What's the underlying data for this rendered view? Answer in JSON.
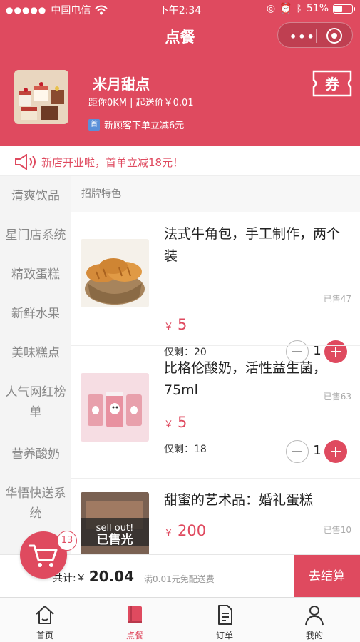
{
  "status_bar": {
    "carrier": "中国电信",
    "time": "下午2:34",
    "battery": "51%",
    "battery_level": 0.51
  },
  "header": {
    "title": "点餐"
  },
  "shop": {
    "name": "米月甜点",
    "meta": "距你0KM | 起送价￥0.01",
    "promo_tag": "首",
    "promo": "新顾客下单立减6元",
    "coupon_label": "券"
  },
  "notice": {
    "text": "新店开业啦，首单立减18元！"
  },
  "categories": [
    {
      "label": "清爽饮品"
    },
    {
      "label": "星门店系统"
    },
    {
      "label": "精致蛋糕"
    },
    {
      "label": "新鲜水果"
    },
    {
      "label": "美味糕点"
    },
    {
      "label": "人气网红榜单"
    },
    {
      "label": "营养酸奶"
    },
    {
      "label": "华悟快送系统"
    }
  ],
  "section": {
    "title": "招牌特色"
  },
  "products": [
    {
      "name": "法式牛角包，手工制作，两个装",
      "sold": "已售47",
      "currency": "￥",
      "price": "5",
      "stock": "仅剩：20",
      "qty": "1"
    },
    {
      "name": "比格伦酸奶，活性益生菌，75ml",
      "sold": "已售63",
      "currency": "￥",
      "price": "5",
      "stock": "仅剩：18",
      "qty": "1"
    },
    {
      "name": "甜蜜的艺术品：婚礼蛋糕",
      "sold": "已售10",
      "currency": "￥",
      "price": "200",
      "sold_out_en": "sell out!",
      "sold_out_cn": "已售光"
    }
  ],
  "cart": {
    "badge": "13",
    "total_label": "共计:￥",
    "total": "20.04",
    "free_delivery": "满0.01元免配送费",
    "checkout": "去结算"
  },
  "tabs": [
    {
      "label": "首页",
      "icon": "home-icon"
    },
    {
      "label": "点餐",
      "icon": "book-icon",
      "active": true
    },
    {
      "label": "订单",
      "icon": "document-icon"
    },
    {
      "label": "我的",
      "icon": "user-icon"
    }
  ],
  "colors": {
    "primary": "#df4a5f",
    "sidebar_bg": "#f4f4f4"
  }
}
